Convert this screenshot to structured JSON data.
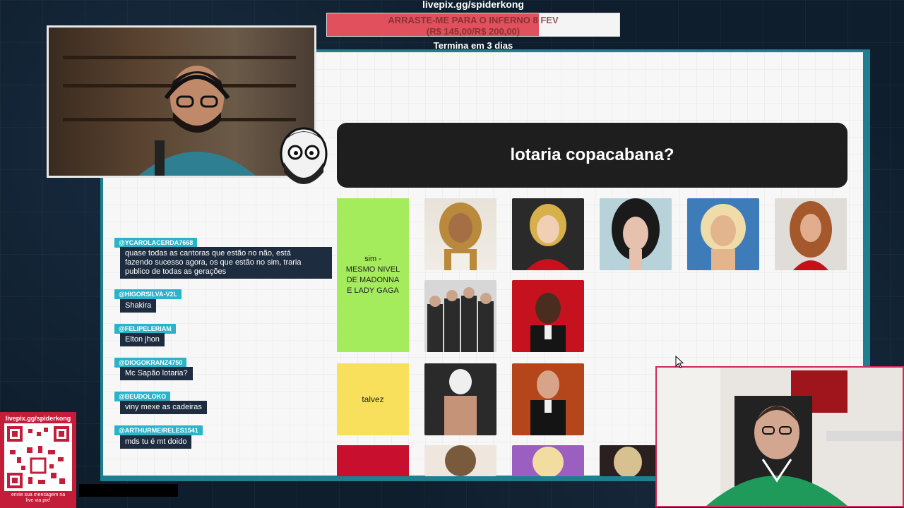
{
  "overlay": {
    "donate_url": "livepix.gg/spiderkong",
    "goal_text": "ARRASTE-ME PARA O INFERNO 8 FEV",
    "goal_amount": "(R$ 145,00/R$ 200,00)",
    "goal_progress": 0.725,
    "goal_time": "Termina em 3 dias"
  },
  "board": {
    "title": "lotaria copacabana?",
    "tiers": [
      {
        "label_lines": [
          "sim -",
          "MESMO NIVEL",
          "DE MADONNA",
          "E LADY GAGA"
        ],
        "color": "#a4ec5c"
      },
      {
        "label_lines": [
          "talvez"
        ],
        "color": "#f8e05c"
      },
      {
        "label_lines": [
          ""
        ],
        "color": "#c8102e"
      }
    ]
  },
  "chat": [
    {
      "user": "@YCAROLACERDA7668",
      "msg_lines": [
        "quase todas as cantoras que estão no não, está",
        "fazendo sucesso agora, os que estão no sim, traria",
        "publico de todas as gerações"
      ]
    },
    {
      "user": "@HIGORSILVA-V2L",
      "msg_lines": [
        "Shakira"
      ]
    },
    {
      "user": "@FELIPELERIAM",
      "msg_lines": [
        "Elton jhon"
      ]
    },
    {
      "user": "@DIOGOKRANZ4750",
      "msg_lines": [
        "Mc Sapão lotaria?"
      ]
    },
    {
      "user": "@BEUDOLOKO",
      "msg_lines": [
        "viny mexe as cadeiras"
      ]
    },
    {
      "user": "@ARTHURMEIRELES1541",
      "msg_lines": [
        "mds tu é mt doido"
      ]
    }
  ],
  "qr": {
    "url": "livepix.gg/spiderkong",
    "caption_lines": [
      "envie sua mensagem na",
      "live via pix!"
    ]
  },
  "colors": {
    "accent_teal": "#2bb3c9",
    "goal_red": "#e0505d",
    "cam2_border": "#d12a58"
  }
}
